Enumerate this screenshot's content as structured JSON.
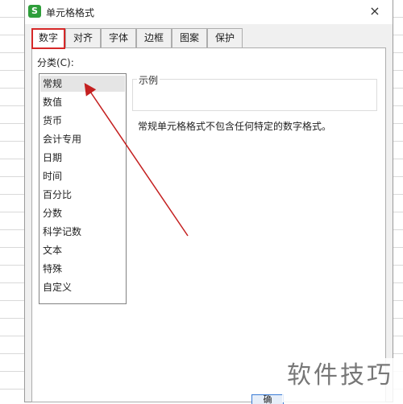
{
  "window": {
    "title": "单元格格式",
    "app_logo": "S",
    "close_label": "×"
  },
  "tabs": [
    {
      "label": "数字"
    },
    {
      "label": "对齐"
    },
    {
      "label": "字体"
    },
    {
      "label": "边框"
    },
    {
      "label": "图案"
    },
    {
      "label": "保护"
    }
  ],
  "active_tab": "数字",
  "category": {
    "label": "分类(C):",
    "selected": "常规",
    "items": [
      "常规",
      "数值",
      "货币",
      "会计专用",
      "日期",
      "时间",
      "百分比",
      "分数",
      "科学记数",
      "文本",
      "特殊",
      "自定义"
    ]
  },
  "sample": {
    "title": "示例"
  },
  "description": "常规单元格格式不包含任何特定的数字格式。",
  "ok_button_label": "确",
  "watermark": "软件技巧",
  "colors": {
    "annotation_red": "#d62828",
    "logo_green": "#2e9e3a"
  }
}
